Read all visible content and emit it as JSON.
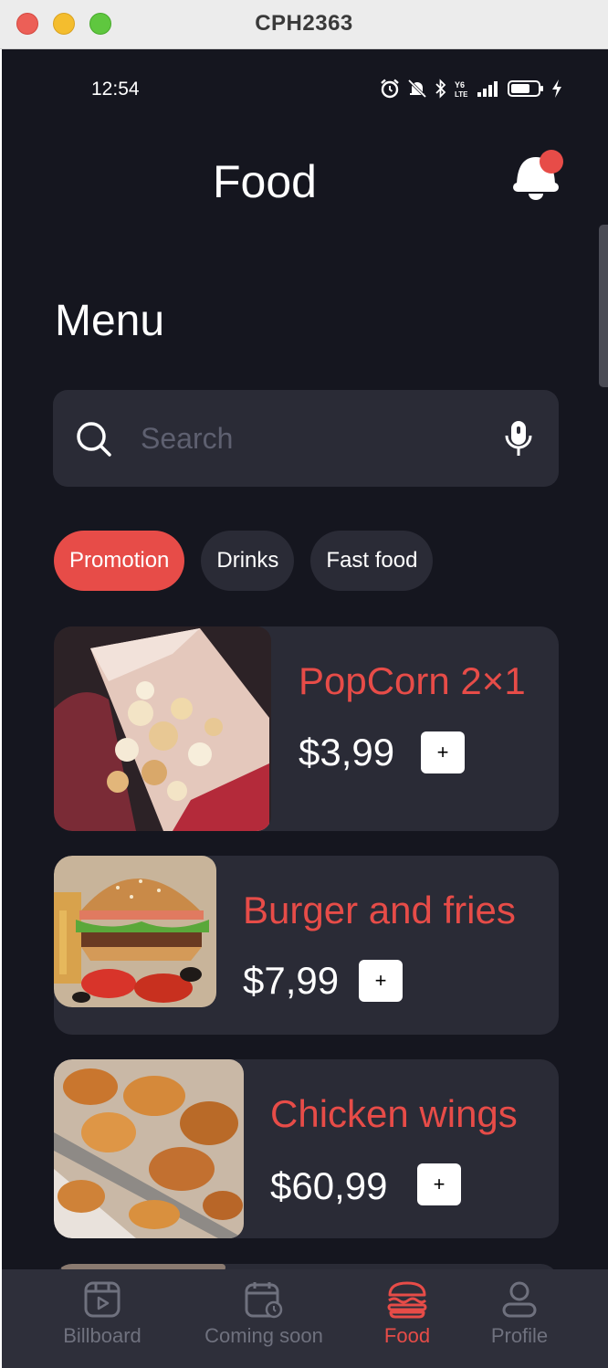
{
  "window": {
    "title": "CPH2363"
  },
  "status_bar": {
    "time": "12:54",
    "icons": [
      "alarm-icon",
      "bell-muted-icon",
      "bluetooth-icon",
      "volte-icon",
      "signal-icon",
      "battery-icon",
      "charging-icon"
    ]
  },
  "header": {
    "title": "Food",
    "notification_icon": "bell-icon",
    "has_badge": true
  },
  "menu": {
    "title": "Menu"
  },
  "search": {
    "placeholder": "Search",
    "value": ""
  },
  "categories": [
    {
      "label": "Promotion",
      "active": true
    },
    {
      "label": "Drinks",
      "active": false
    },
    {
      "label": "Fast food",
      "active": false
    }
  ],
  "items": [
    {
      "name": "PopCorn 2×1",
      "price": "$3,99",
      "add_label": "+",
      "image": "popcorn-image"
    },
    {
      "name": "Burger and fries",
      "price": "$7,99",
      "add_label": "+",
      "image": "burger-image"
    },
    {
      "name": "Chicken wings",
      "price": "$60,99",
      "add_label": "+",
      "image": "chicken-image"
    }
  ],
  "bottom_nav": [
    {
      "label": "Billboard",
      "icon": "billboard-icon",
      "active": false
    },
    {
      "label": "Coming soon",
      "icon": "calendar-clock-icon",
      "active": false
    },
    {
      "label": "Food",
      "icon": "burger-icon",
      "active": true
    },
    {
      "label": "Profile",
      "icon": "user-icon",
      "active": false
    }
  ],
  "colors": {
    "accent": "#e74c48",
    "background": "#15161f",
    "card": "#2a2b36",
    "nav_bg": "#2e2f3a",
    "inactive": "#6f717e"
  }
}
